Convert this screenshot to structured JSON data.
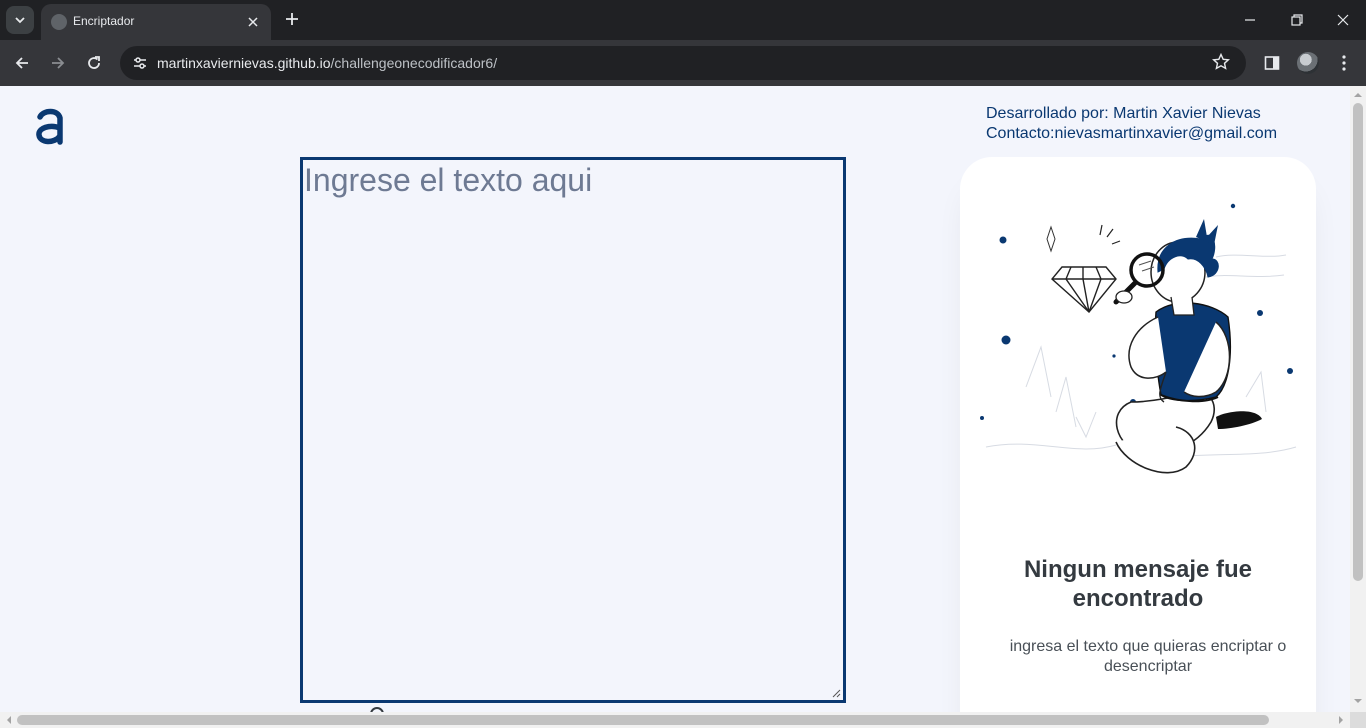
{
  "browser": {
    "tab_title": "Encriptador",
    "url_host": "martinxaviernievas.github.io",
    "url_path": "/challengeonecodificador6/"
  },
  "header": {
    "logo_letter": "a",
    "developer_line": "Desarrollado por: Martin Xavier Nievas",
    "contact_line": "Contacto:nievasmartinxavier@gmail.com"
  },
  "input": {
    "placeholder": "Ingrese el texto aqui",
    "value": ""
  },
  "output_card": {
    "title": "Ningun mensaje fue encontrado",
    "text": "ingresa el texto que quieras encriptar o desencriptar"
  },
  "colors": {
    "brand": "#0a3871",
    "page_bg": "#f3f5fc",
    "card_bg": "#ffffff"
  }
}
